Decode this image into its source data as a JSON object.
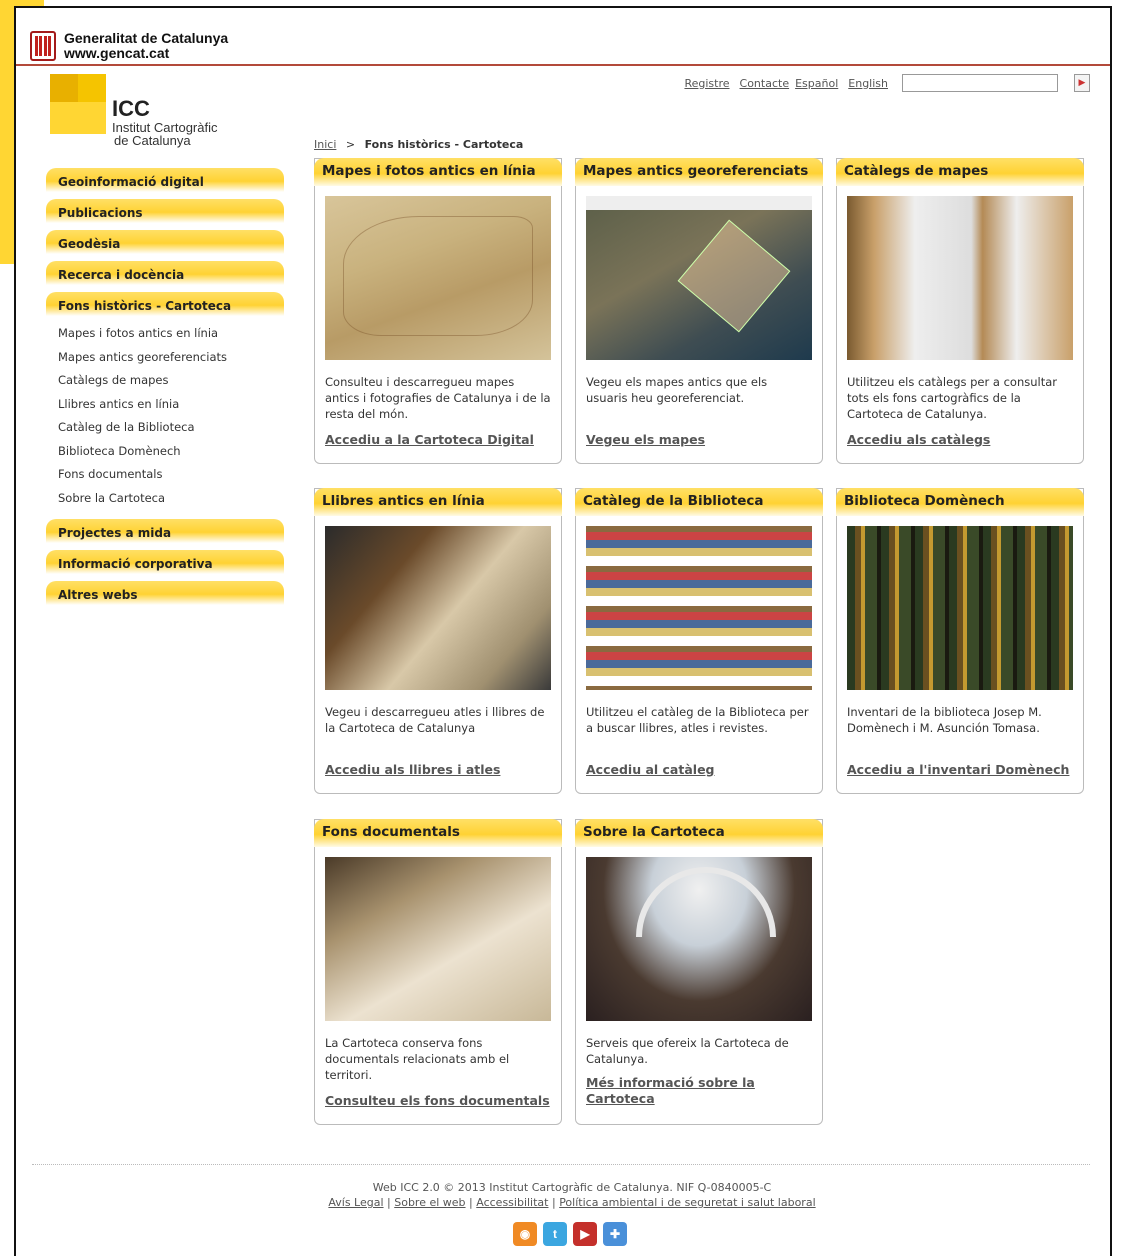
{
  "gencat": {
    "line1": "Generalitat de Catalunya",
    "line2": "www.gencat.cat"
  },
  "icc": {
    "name": "ICC",
    "sub1": "Institut Cartogràfic",
    "sub2": "de Catalunya"
  },
  "top_links": [
    "Registre",
    "Contacte",
    "Español",
    "English"
  ],
  "search": {
    "placeholder": "",
    "button_icon": "play-arrow-icon"
  },
  "breadcrumb": {
    "home": "Inici",
    "sep": ">",
    "current": "Fons històrics - Cartoteca"
  },
  "sidebar": {
    "sections": [
      "Geoinformació digital",
      "Publicacions",
      "Geodèsia",
      "Recerca i docència",
      "Fons històrics - Cartoteca"
    ],
    "subitems": [
      "Mapes i fotos antics en línia",
      "Mapes antics georeferenciats",
      "Catàlegs de mapes",
      "Llibres antics en línia",
      "Catàleg de la Biblioteca",
      "Biblioteca Domènech",
      "Fons documentals",
      "Sobre la Cartoteca"
    ],
    "sections_after": [
      "Projectes a mida",
      "Informació corporativa",
      "Altres webs"
    ]
  },
  "cards": [
    {
      "title": "Mapes i fotos antics en línia",
      "text": "Consulteu i descarregueu mapes antics i fotografies de Catalunya i de la resta del món.",
      "link": "Accediu a la Cartoteca Digital"
    },
    {
      "title": "Mapes antics georeferenciats",
      "text": "Vegeu els mapes antics que els usuaris heu georeferenciat.",
      "link": "Vegeu els mapes"
    },
    {
      "title": "Catàlegs de mapes",
      "text": "Utilitzeu els catàlegs per a consultar tots els fons cartogràfics de la Cartoteca de Catalunya.",
      "link": "Accediu als catàlegs"
    },
    {
      "title": "Llibres antics en línia",
      "text": "Vegeu i descarregueu atles i llibres de la Cartoteca de Catalunya",
      "link": "Accediu als llibres i atles"
    },
    {
      "title": "Catàleg de la Biblioteca",
      "text": "Utilitzeu el catàleg de la Biblioteca per a buscar llibres, atles i revistes.",
      "link": "Accediu al catàleg"
    },
    {
      "title": "Biblioteca Domènech",
      "text": "Inventari de la biblioteca Josep M. Domènech i M. Asunción Tomasa.",
      "link": "Accediu a l'inventari Domènech"
    },
    {
      "title": "Fons documentals",
      "text": "La Cartoteca conserva fons documentals relacionats amb el territori.",
      "link": "Consulteu els fons documentals"
    },
    {
      "title": "Sobre la Cartoteca",
      "text": "Serveis que ofereix la Cartoteca de Catalunya.",
      "link": "Més informació sobre la Cartoteca"
    }
  ],
  "footer": {
    "copyright": "Web ICC 2.0 © 2013 Institut Cartogràfic de Catalunya. NIF Q-0840005-C",
    "links": [
      "Avís Legal",
      "Sobre el web",
      "Accessibilitat",
      "Política ambiental i de seguretat i salut laboral"
    ],
    "social": [
      {
        "name": "rss-icon",
        "glyph": "◉",
        "color": "#F08A24"
      },
      {
        "name": "twitter-icon",
        "glyph": "t",
        "color": "#3BA6E0"
      },
      {
        "name": "youtube-icon",
        "glyph": "▶",
        "color": "#C4302B"
      },
      {
        "name": "share-icon",
        "glyph": "✚",
        "color": "#4A90D9"
      }
    ]
  }
}
